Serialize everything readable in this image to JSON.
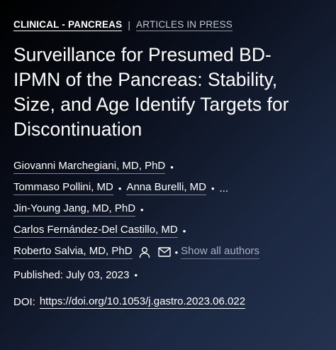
{
  "header": {
    "section": "CLINICAL - PANCREAS",
    "separator": "|",
    "article_type": "ARTICLES IN PRESS"
  },
  "title": "Surveillance for Presumed BD-IPMN of the Pancreas: Stability, Size, and Age Identify Targets for Discontinuation",
  "authors": {
    "line1": [
      "Giovanni Marchegiani, MD, PhD"
    ],
    "line2": [
      "Tommaso Pollini, MD",
      "Anna Burelli, MD"
    ],
    "line3": [
      "Jin-Young Jang, MD, PhD"
    ],
    "line4": [
      "Carlos Fernández-Del Castillo, MD"
    ],
    "line5": [
      "Roberto Salvia, MD, PhD"
    ],
    "ellipsis": "...",
    "bullet": "•",
    "show_all": "Show all authors",
    "icons": {
      "person": "person-icon",
      "mail": "mail-icon"
    }
  },
  "published": {
    "text": "Published: July 03, 2023"
  },
  "doi": {
    "label": "DOI:",
    "link": "https://doi.org/10.1053/j.gastro.2023.06.022"
  },
  "colors": {
    "background_start": "#000000",
    "background_end": "#24324f",
    "muted_text": "#a8b1c2"
  }
}
